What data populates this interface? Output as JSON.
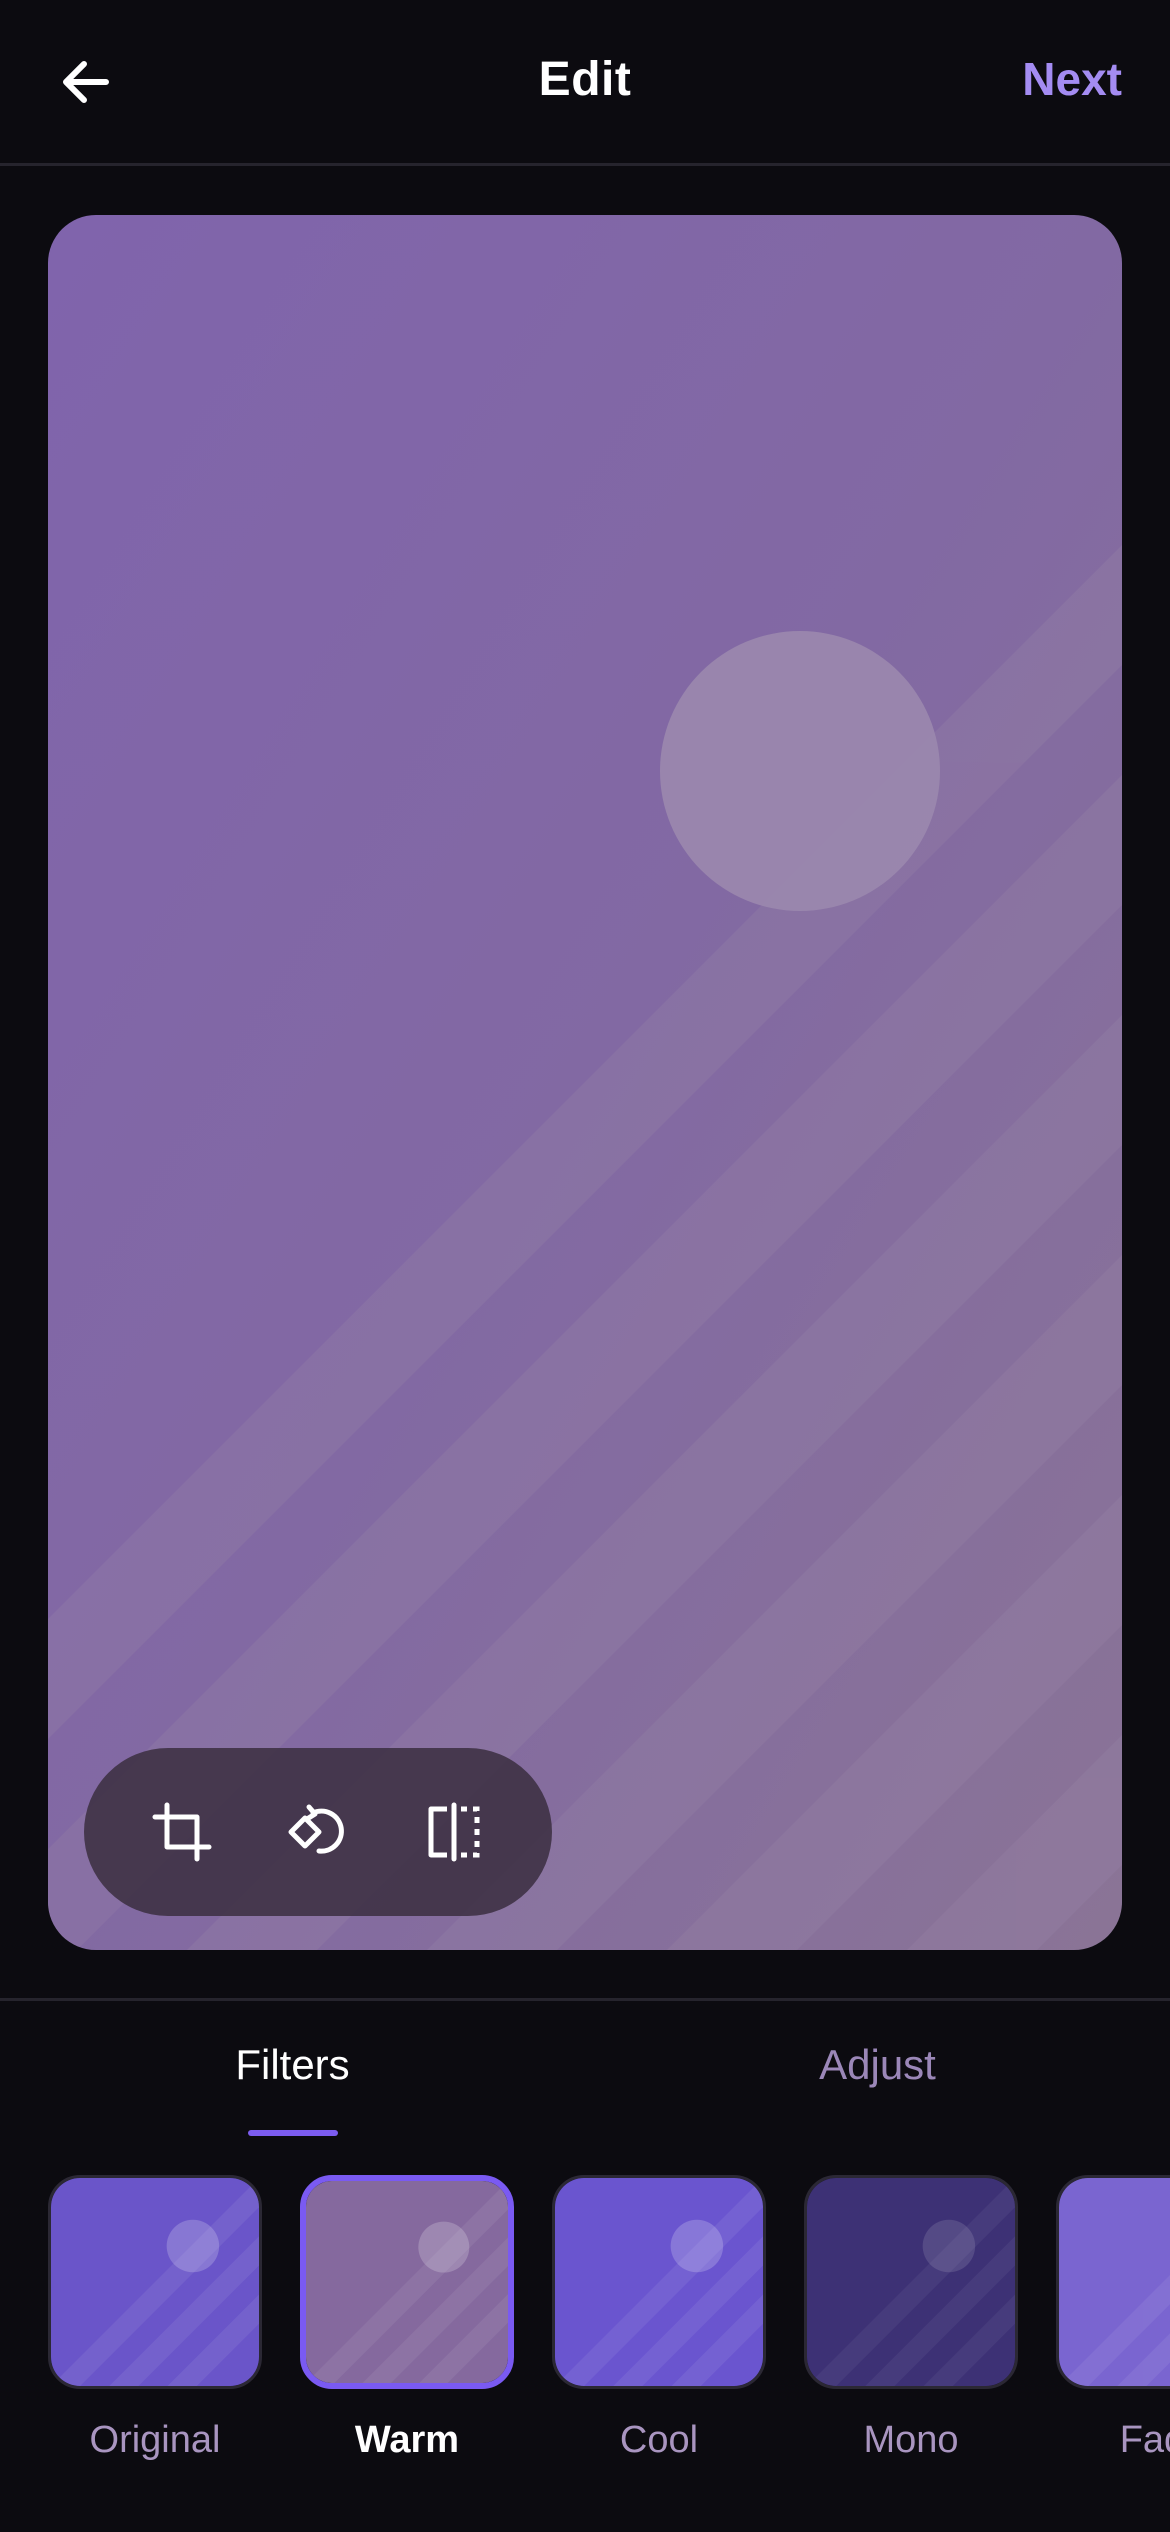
{
  "header": {
    "title": "Edit",
    "next_label": "Next",
    "accent_color": "#a48cf2"
  },
  "preview": {
    "tools": [
      "crop-icon",
      "rotate-icon",
      "flip-icon"
    ]
  },
  "tabs": [
    {
      "label": "Filters",
      "active": true
    },
    {
      "label": "Adjust",
      "active": false
    }
  ],
  "filters": [
    {
      "label": "Original",
      "selected": false
    },
    {
      "label": "Warm",
      "selected": true
    },
    {
      "label": "Cool",
      "selected": false
    },
    {
      "label": "Mono",
      "selected": false
    },
    {
      "label": "Fade",
      "selected": false
    }
  ]
}
